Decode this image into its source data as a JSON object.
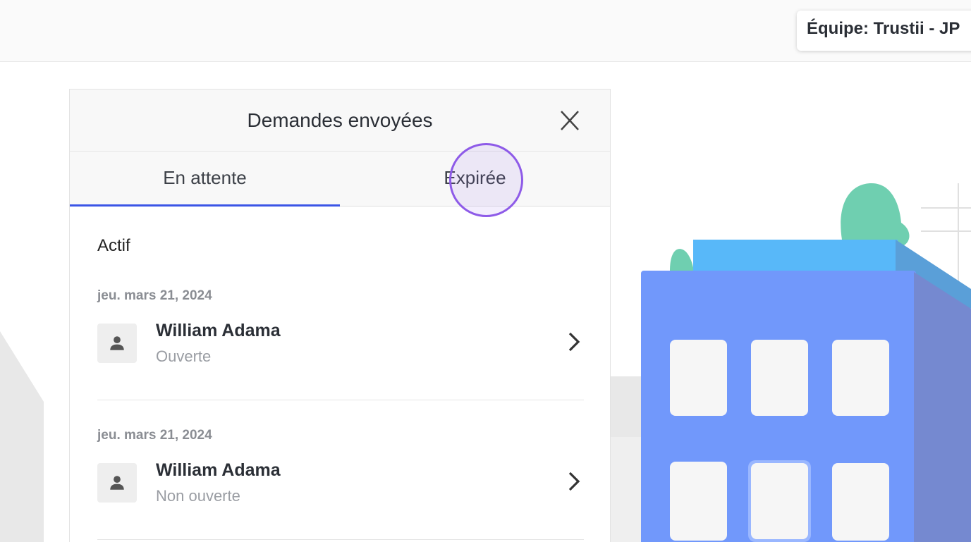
{
  "header": {
    "team_label": "Équipe: Trustii - JP"
  },
  "panel": {
    "title": "Demandes envoyées",
    "tabs": [
      {
        "label": "En attente",
        "active": true
      },
      {
        "label": "Expirée",
        "active": false
      }
    ],
    "section_label": "Actif",
    "requests": [
      {
        "date": "jeu. mars 21, 2024",
        "name": "William Adama",
        "status": "Ouverte"
      },
      {
        "date": "jeu. mars 21, 2024",
        "name": "William Adama",
        "status": "Non ouverte"
      }
    ]
  },
  "icons": {
    "close": "close-icon",
    "avatar": "person-icon",
    "chevron": "chevron-right-icon"
  },
  "colors": {
    "tab_active_underline": "#3b55e6",
    "click_indicator": "#8e5be8",
    "building": "#7198fb"
  }
}
